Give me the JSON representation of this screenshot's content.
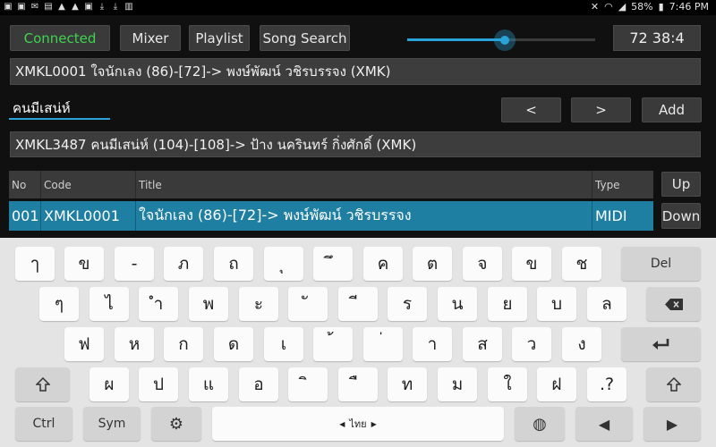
{
  "status_bar": {
    "battery": "58%",
    "time": "7:46 PM",
    "left_icons": [
      "image-icon",
      "image-icon",
      "mail-icon",
      "box-icon",
      "warning-icon",
      "warning-icon",
      "image-icon",
      "download-icon",
      "download-icon",
      "bag-icon"
    ],
    "right_icons": [
      "mute-icon",
      "wifi-icon",
      "signal-icon",
      "battery-icon"
    ]
  },
  "toolbar": {
    "connected": "Connected",
    "mixer": "Mixer",
    "playlist": "Playlist",
    "song_search": "Song Search",
    "counter": "72  38:4",
    "volume_level": 0.52
  },
  "now_playing": "XMKL0001 ใจนักเลง (86)-[72]-> พงษ์พัฒน์ วชิรบรรจง (XMK)",
  "search": {
    "value": "คนมีเสน่ห์"
  },
  "nav": {
    "prev": "<",
    "next": ">",
    "add": "Add"
  },
  "search_result": "XMKL3487 คนมีเสน่ห์ (104)-[108]-> ป้าง นครินทร์ กิ่งศักดิ์ (XMK)",
  "table": {
    "headers": [
      "No",
      "Code",
      "Title",
      "Type"
    ],
    "rows": [
      [
        "001",
        "XMKL0001",
        "ใจนักเลง (86)-[72]-> พงษ์พัฒน์ วชิรบรรจง",
        "MIDI"
      ]
    ],
    "up": "Up",
    "down": "Down"
  },
  "keyboard": {
    "row1": [
      "ๅ",
      "ข",
      "-",
      "ภ",
      "ถ",
      "ุ",
      "ึ",
      "ค",
      "ต",
      "จ",
      "ข",
      "ช"
    ],
    "del": "Del",
    "row2": [
      "ๆ",
      "ไ",
      "ำ",
      "พ",
      "ะ",
      "ั",
      "ี",
      "ร",
      "น",
      "ย",
      "บ",
      "ล"
    ],
    "row3": [
      "ฟ",
      "ห",
      "ก",
      "ด",
      "เ",
      "้",
      "่",
      "า",
      "ส",
      "ว",
      "ง"
    ],
    "row4": [
      "ผ",
      "ป",
      "แ",
      "อ",
      "ิ",
      "ื",
      "ท",
      "ม",
      "ใ",
      "ฝ",
      ".?"
    ],
    "ctrl": "Ctrl",
    "sym": "Sym",
    "language": "ไทย",
    "backspace_icon": "backspace-icon",
    "enter_icon": "enter-icon",
    "shift_icon": "shift-icon",
    "settings_icon": "gear-icon",
    "globe_icon": "globe-icon"
  }
}
